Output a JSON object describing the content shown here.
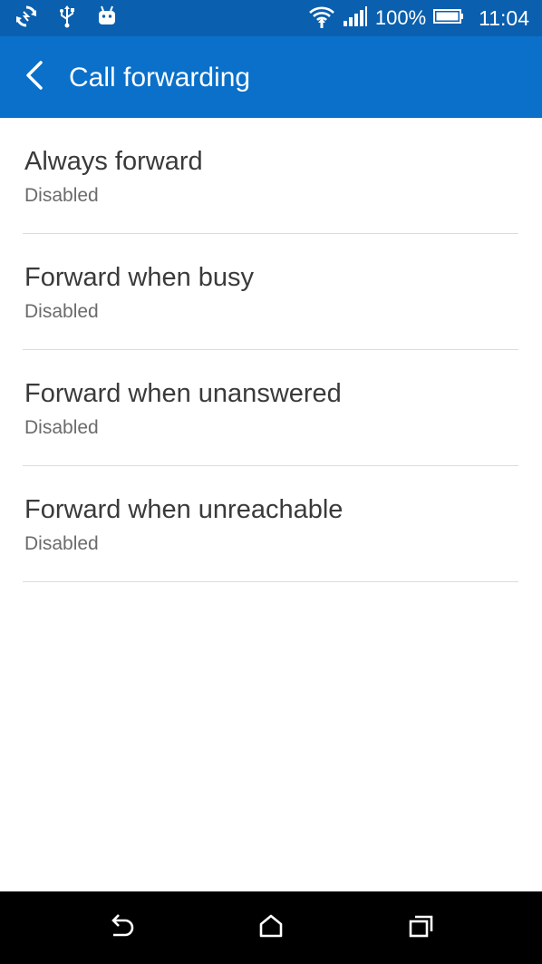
{
  "status_bar": {
    "battery_percent": "100%",
    "time": "11:04",
    "icons": [
      "sync-icon",
      "usb-icon",
      "android-icon",
      "wifi-icon",
      "signal-icon",
      "battery-icon"
    ]
  },
  "header": {
    "title": "Call forwarding",
    "back_icon": "back-arrow-icon"
  },
  "items": [
    {
      "title": "Always forward",
      "summary": "Disabled"
    },
    {
      "title": "Forward when busy",
      "summary": "Disabled"
    },
    {
      "title": "Forward when unanswered",
      "summary": "Disabled"
    },
    {
      "title": "Forward when unreachable",
      "summary": "Disabled"
    }
  ],
  "nav_bar": {
    "icons": [
      "nav-back-icon",
      "nav-home-icon",
      "nav-recents-icon"
    ]
  },
  "colors": {
    "status_bar": "#0a5fae",
    "app_bar": "#0a70c9",
    "title_text": "#3a3a3a",
    "summary_text": "#6b6b6b",
    "divider": "#dcdcdc",
    "nav_bar": "#000000"
  }
}
